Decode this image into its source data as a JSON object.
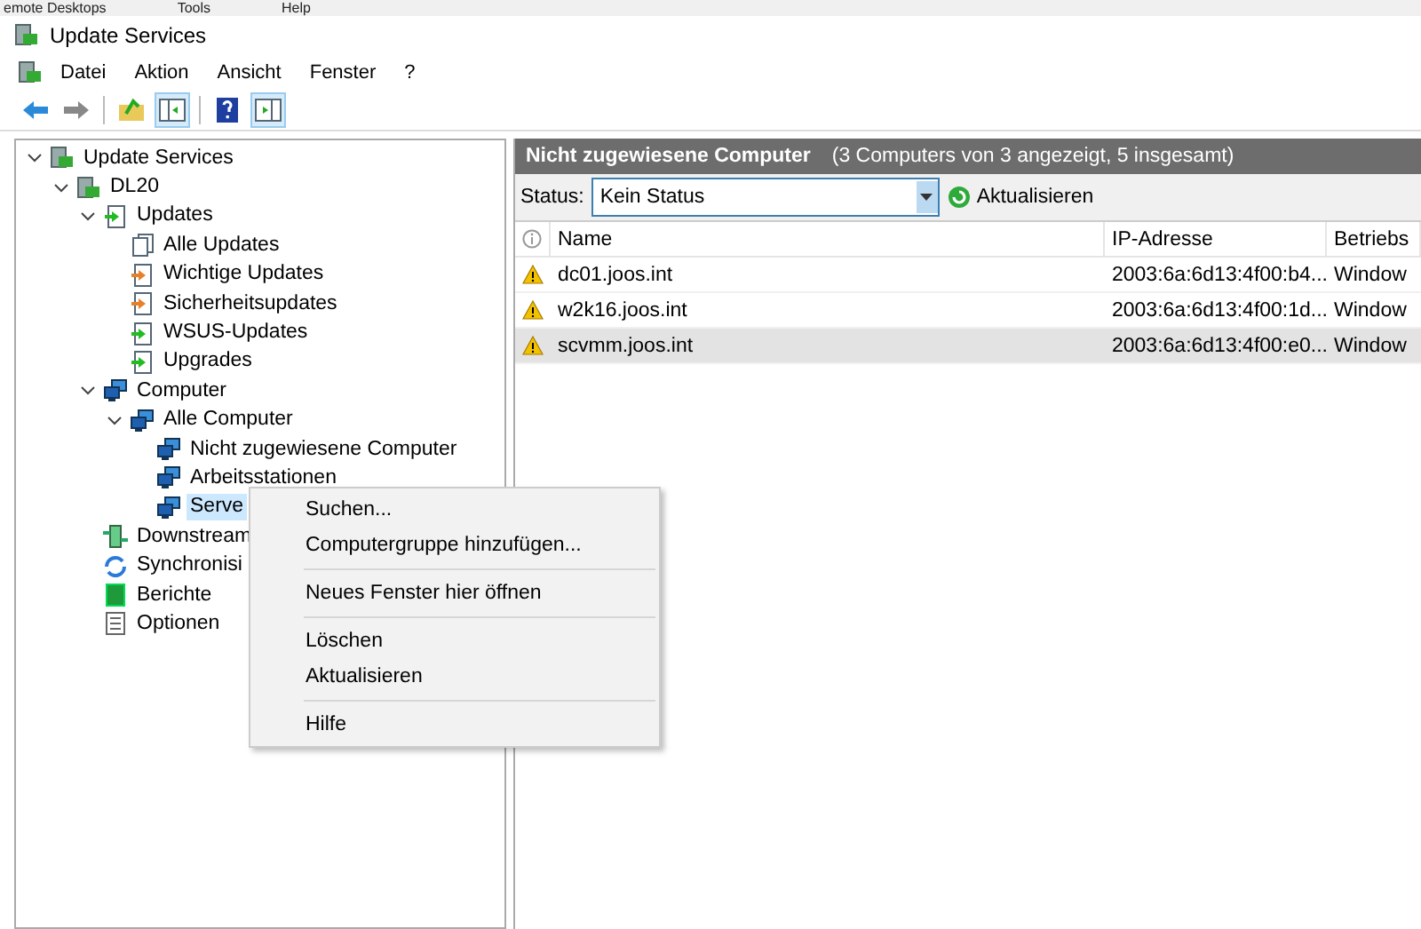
{
  "top_menu": [
    "emote Desktops",
    "Tools",
    "Help"
  ],
  "window": {
    "title": "Update Services"
  },
  "menu": [
    "Datei",
    "Aktion",
    "Ansicht",
    "Fenster",
    "?"
  ],
  "toolbar": [
    {
      "kind": "back",
      "on": false
    },
    {
      "kind": "forward",
      "on": false
    },
    {
      "kind": "separator"
    },
    {
      "kind": "up",
      "on": false
    },
    {
      "kind": "pane",
      "on": true
    },
    {
      "kind": "separator"
    },
    {
      "kind": "help",
      "on": false
    },
    {
      "kind": "pane2",
      "on": true
    }
  ],
  "tree": [
    {
      "label": "Update Services",
      "kind": "server",
      "expanded": true,
      "selected": false,
      "children": [
        {
          "label": "DL20",
          "kind": "server",
          "expanded": true,
          "selected": false,
          "children": [
            {
              "label": "Updates",
              "kind": "updates",
              "expanded": true,
              "selected": false,
              "children": [
                {
                  "label": "Alle Updates",
                  "kind": "all-updates",
                  "selected": false
                },
                {
                  "label": "Wichtige Updates",
                  "kind": "important-updates",
                  "selected": false
                },
                {
                  "label": "Sicherheitsupdates",
                  "kind": "important-updates",
                  "selected": false
                },
                {
                  "label": "WSUS-Updates",
                  "kind": "updates",
                  "selected": false
                },
                {
                  "label": "Upgrades",
                  "kind": "updates",
                  "selected": false
                }
              ]
            },
            {
              "label": "Computer",
              "kind": "computers",
              "expanded": true,
              "selected": false,
              "children": [
                {
                  "label": "Alle Computer",
                  "kind": "computers",
                  "expanded": true,
                  "selected": false,
                  "children": [
                    {
                      "label": "Nicht zugewiesene Computer",
                      "kind": "computers",
                      "selected": false
                    },
                    {
                      "label": "Arbeitsstationen",
                      "kind": "computers",
                      "selected": false
                    },
                    {
                      "label": "Serve",
                      "kind": "computers",
                      "selected": true
                    }
                  ]
                }
              ]
            },
            {
              "label": "Downstream",
              "kind": "downstream",
              "selected": false
            },
            {
              "label": "Synchronisi",
              "kind": "sync",
              "selected": false
            },
            {
              "label": "Berichte",
              "kind": "report",
              "selected": false
            },
            {
              "label": "Optionen",
              "kind": "options",
              "selected": false
            }
          ]
        }
      ]
    }
  ],
  "panel": {
    "title": "Nicht zugewiesene Computer",
    "subtitle": "(3 Computers von 3 angezeigt, 5 insgesamt)"
  },
  "filter": {
    "label": "Status:",
    "value": "Kein Status",
    "refresh": "Aktualisieren"
  },
  "table": {
    "columns": [
      "Name",
      "IP-Adresse",
      "Betriebs"
    ],
    "rows": [
      {
        "name": "dc01.joos.int",
        "ip": "2003:6a:6d13:4f00:b4...",
        "column_3": "Window",
        "selected": false
      },
      {
        "name": "w2k16.joos.int",
        "ip": "2003:6a:6d13:4f00:1d...",
        "column_3": "Window",
        "selected": false
      },
      {
        "name": "scvmm.joos.int",
        "ip": "2003:6a:6d13:4f00:e0...",
        "column_3": "Window",
        "selected": true
      }
    ]
  },
  "context_menu": {
    "groups": [
      [
        "Suchen...",
        "Computergruppe hinzufügen..."
      ],
      [
        "Neues Fenster hier öffnen"
      ],
      [
        "Löschen",
        "Aktualisieren"
      ],
      [
        "Hilfe"
      ]
    ]
  }
}
